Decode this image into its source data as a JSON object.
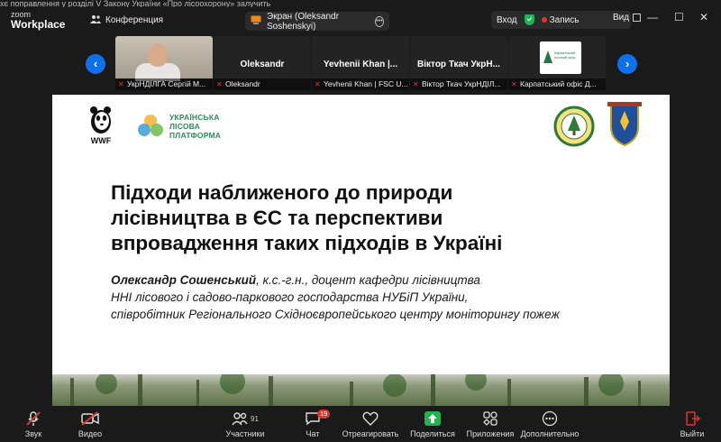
{
  "window": {
    "ticker_text": "хє поправлення у розділі V Закону України «Про лісоохорону» залучить",
    "brand_line1": "zoom",
    "brand_line2": "Workplace",
    "conference_label": "Конференция",
    "share_label": "Экран (Oleksandr Soshenskyi)",
    "enter_label": "Вход",
    "record_label": "Запись",
    "view_label": "Вид",
    "minimize_glyph": "—",
    "maximize_glyph": "☐",
    "close_glyph": "✕"
  },
  "gallery": {
    "prev_glyph": "‹",
    "next_glyph": "›",
    "tiles": [
      {
        "top_name": "",
        "caption": "УкрНДІЛГА Сергій М..."
      },
      {
        "top_name": "Oleksandr",
        "caption": "Oleksandr"
      },
      {
        "top_name": "Yevhenii Khan |...",
        "caption": "Yevhenii Khan | FSC U..."
      },
      {
        "top_name": "Віктор Ткач УкрН...",
        "caption": "Віктор Ткач УкрНДІЛ..."
      },
      {
        "top_name": "",
        "caption": "Карпатський офіс Д..."
      }
    ],
    "logo_card_text": "Карпатський лісовий офіс"
  },
  "slide": {
    "wwf_label": "WWF",
    "ulp_line1": "УКРАЇНСЬКА",
    "ulp_line2": "ЛІСОВА",
    "ulp_line3": "ПЛАТФОРМА",
    "title_line1": "Підходи наближеного до природи",
    "title_line2": "лісівництва в ЄС та перспективи",
    "title_line3": "впровадження таких підходів в Україні",
    "author_name": "Олександр Сошенський",
    "author_line1_rest": ", к.с.-г.н., доцент кафедри лісівництва",
    "author_line2": "ННІ лісового і садово-паркового господарства НУБіП України,",
    "author_line3": "співробітник Регіонального Східноєвропейського центру моніторингу пожеж"
  },
  "toolbar": {
    "audio": "Звук",
    "video": "Видео",
    "participants": "Участники",
    "participants_count": "91",
    "chat": "Чат",
    "chat_badge": "19",
    "react": "Отреагировать",
    "share": "Поделиться",
    "apps": "Приложения",
    "more": "Дополнительно",
    "leave": "Выйти"
  },
  "colors": {
    "accent_blue": "#0e71eb",
    "share_green": "#23b14d",
    "alert_red": "#e0342b",
    "security_green": "#1fb35a"
  }
}
